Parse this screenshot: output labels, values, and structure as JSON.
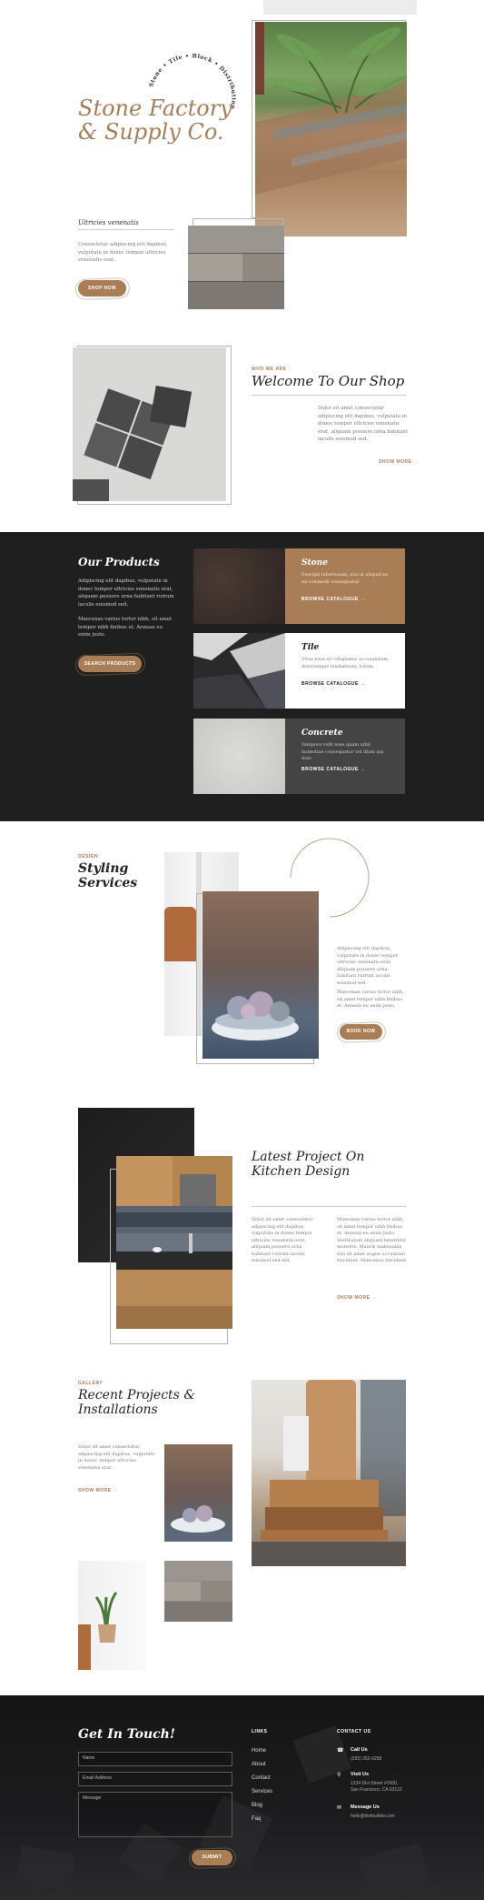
{
  "hero": {
    "circle_text": "Stone • Tile • Block • Distribution in California",
    "title_line1": "Stone Factory",
    "title_line2": "& Supply Co.",
    "subheading": "Ultricies venenatis",
    "text": "Consectetur adipiscing elit dapibus, vulputate in donec tempor ultricies venenatis erat.",
    "button": "SHOP NOW"
  },
  "welcome": {
    "eyebrow": "WHO WE ARE",
    "title": "Welcome To Our Shop",
    "text": "Dolor sit amet consectetur adipiscing elit dapibus, vulputate in donec tempor ultricies venenatis erat, aliquam posuere urna habitant iaculis euismod sed.",
    "link": "SHOW MORE →"
  },
  "products": {
    "title": "Our Products",
    "text1": "Adipiscing elit dapibus, vulputate in donec tempor ultricies venenatis erat, aliquam posuere urna habitant rutrum iaculis euismod sed.",
    "text2": "Maecenas varius tortor nibh, sit amet tempor nibh finibus et. Aenean eu enim justo.",
    "button": "SEARCH PRODUCTS",
    "cards": [
      {
        "name": "Stone",
        "text": "Suscipit laboriosam, nisi ut aliquid ex ea commodi consequatur",
        "link": "BROWSE CATALOGUE →"
      },
      {
        "name": "Tile",
        "text": "Vitae esse sit voluptates accusantium doloremque laudantium, totam.",
        "link": "BROWSE CATALOGUE →"
      },
      {
        "name": "Concrete",
        "text": "Tempore velit esse quam nihil molestiae consequatur vel illum qui dolo",
        "link": "BROWSE CATALOGUE →"
      }
    ]
  },
  "styling": {
    "eyebrow": "DESIGN",
    "title_line1": "Styling",
    "title_line2": "Services",
    "text1": "Adipiscing elit dapibus, vulputate in donec tempor ultricies venenatis erat, aliquam posuere urna habitant rutrum iaculis euismod sed.",
    "text2": "Maecenas varius tortor nibh, sit amet tempor nibh finibus et. Aenean eu enim justo.",
    "button": "BOOK NOW"
  },
  "kitchen": {
    "title_line1": "Latest Project On",
    "title_line2": "Kitchen Design",
    "text_left": "Dolor sit amet consectetur adipiscing elit dapibus, vulputate in donec tempor ultricies venenatis erat, aliquam posuere urna habitant rutrum iaculis euismod sed elit.",
    "text_right": "Maecenas varius tortor nibh, sit amet tempor nibh finibus et. Aenean eu enim justo. Vestibulum aliquam hendrerit molestie. Mauris malesuada nisi sit amet augue accumsan tincidunt. Maecenas tincidunt.",
    "link": "SHOW MORE →"
  },
  "gallery": {
    "eyebrow": "GALLERY",
    "title_line1": "Recent Projects &",
    "title_line2": "Installations",
    "text": "Dolor sit amet consectetur adipiscing elit dapibus, vulputate in donec tempor ultricies venenatis erat.",
    "link": "SHOW MORE →"
  },
  "footer": {
    "title": "Get In Touch!",
    "name_placeholder": "Name",
    "email_placeholder": "Email Address",
    "message_placeholder": "Message",
    "submit": "SUBMIT",
    "links_heading": "LINKS",
    "links": [
      "Home",
      "About",
      "Contact",
      "Services",
      "Blog",
      "Faq"
    ],
    "contact_heading": "CONTACT US",
    "call_label": "Call Us",
    "call_value": "(255) 352-6258",
    "visit_label": "Visit Us",
    "visit_value": "1234 Divi Street #1000, San Francisco, CA 93123",
    "message_label": "Message Us",
    "message_value": "hello@divibuilder.com"
  },
  "colors": {
    "accent": "#a97e57",
    "dark": "#1f1f1f",
    "footer": "#161616"
  }
}
